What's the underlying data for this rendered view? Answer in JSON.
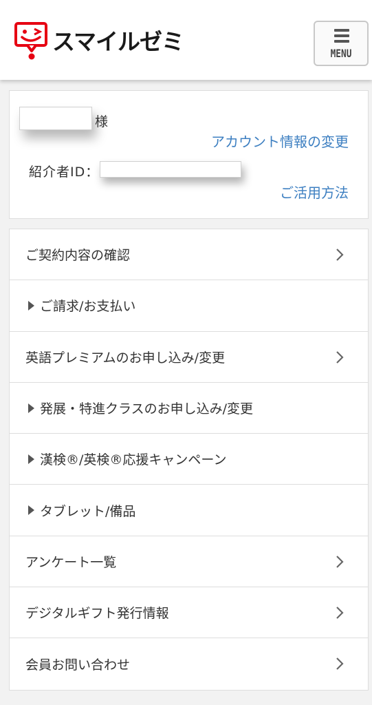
{
  "header": {
    "logo_text": "スマイルゼミ",
    "menu_label": "MENU",
    "brand_color": "#e60012"
  },
  "account": {
    "honorific": "様",
    "change_account_link": "アカウント情報の変更",
    "referrer_label": "紹介者ID：",
    "usage_link": "ご活用方法",
    "link_color": "#3d7fc1"
  },
  "menu": {
    "items": [
      {
        "label": "ご契約内容の確認",
        "icon": "chevron-right-icon"
      },
      {
        "label": "ご請求/お支払い",
        "icon": "triangle-right-icon"
      },
      {
        "label": "英語プレミアムのお申し込み/変更",
        "icon": "chevron-right-icon"
      },
      {
        "label": "発展・特進クラスのお申し込み/変更",
        "icon": "triangle-right-icon"
      },
      {
        "label": "漢検®/英検®応援キャンペーン",
        "icon": "triangle-right-icon"
      },
      {
        "label": "タブレット/備品",
        "icon": "triangle-right-icon"
      },
      {
        "label": "アンケート一覧",
        "icon": "chevron-right-icon"
      },
      {
        "label": "デジタルギフト発行情報",
        "icon": "chevron-right-icon"
      },
      {
        "label": "会員お問い合わせ",
        "icon": "chevron-right-icon"
      }
    ]
  }
}
